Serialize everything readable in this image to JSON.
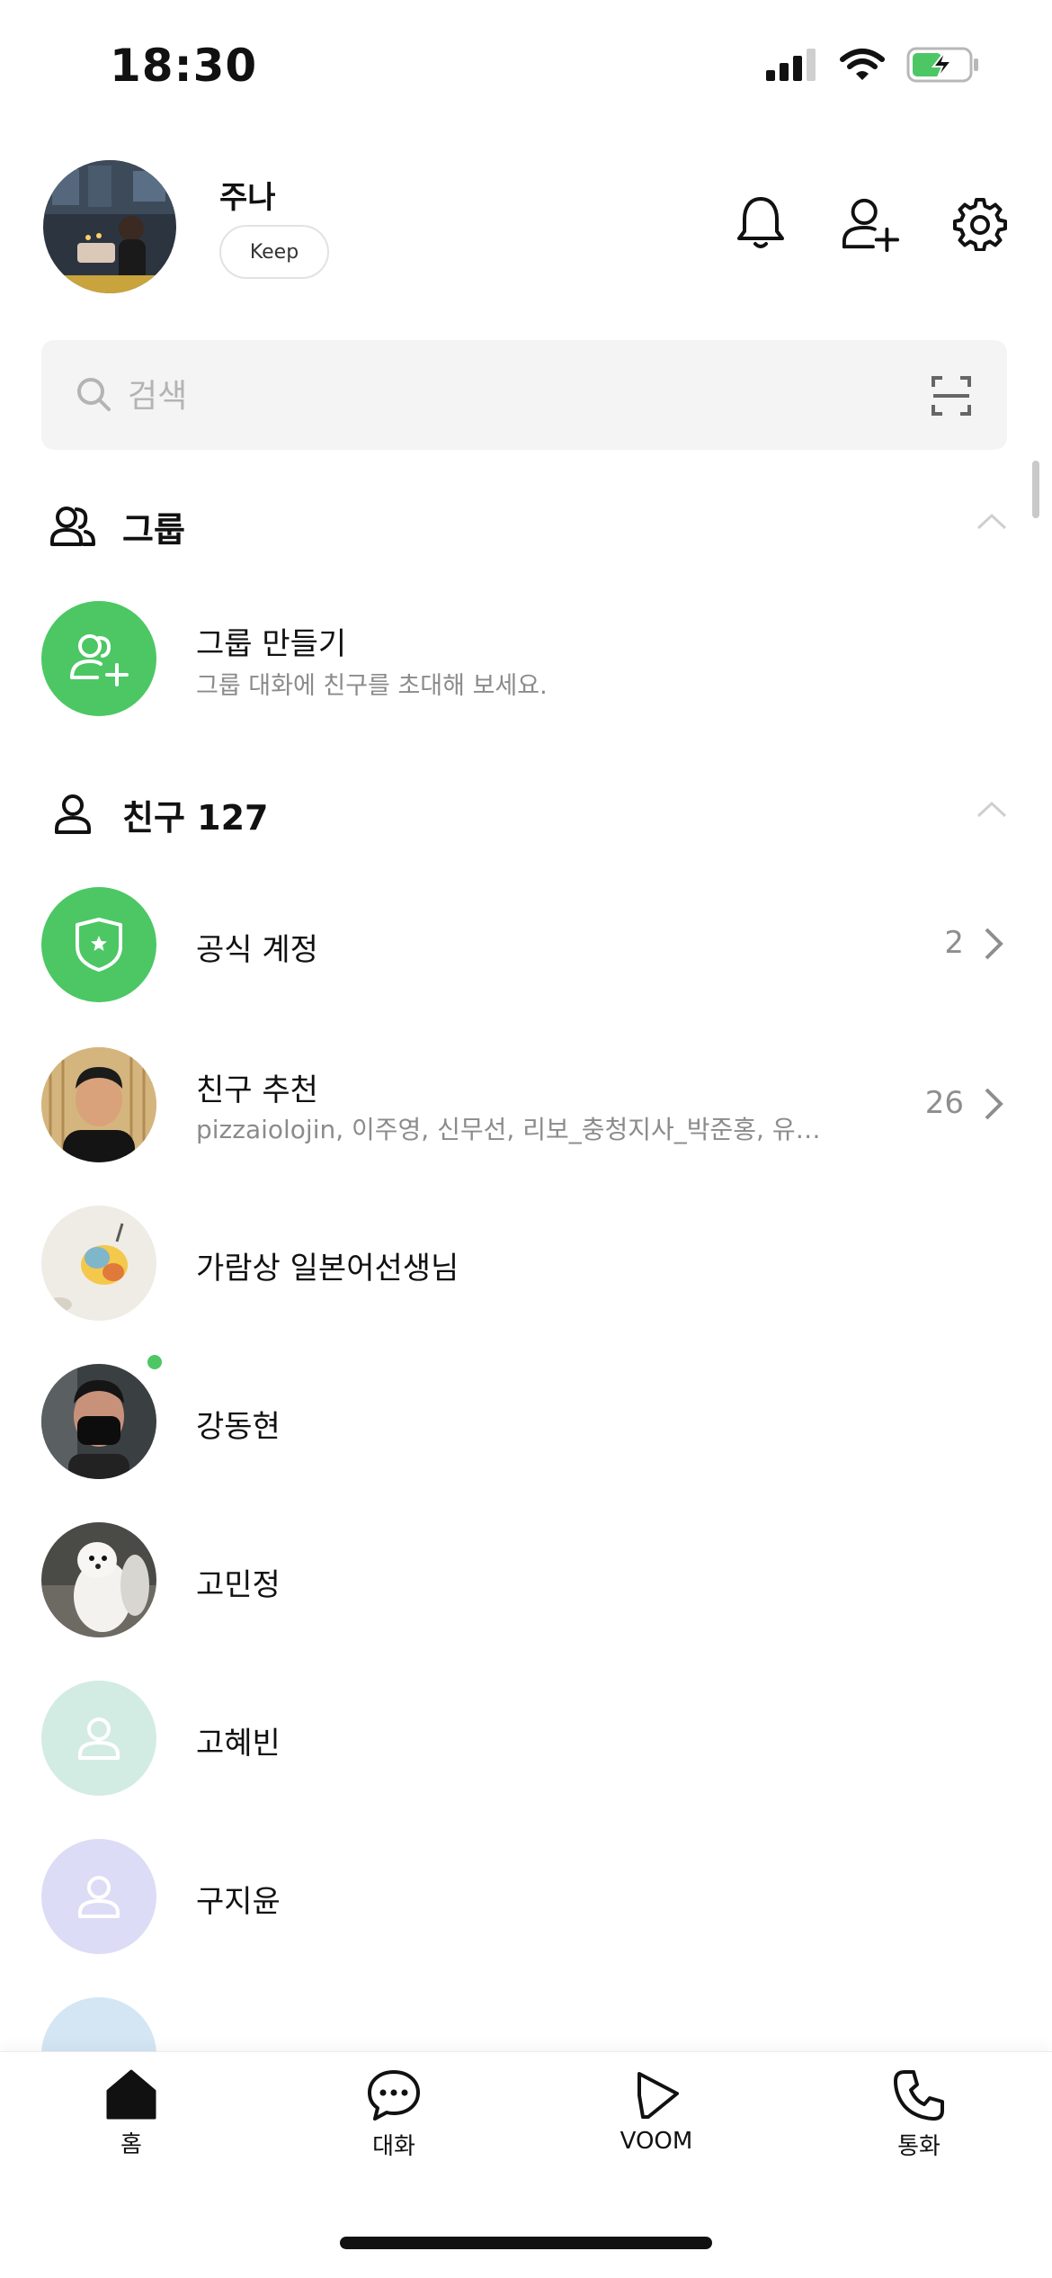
{
  "status_bar": {
    "time": "18:30"
  },
  "profile": {
    "name": "주나",
    "keep_label": "Keep"
  },
  "search": {
    "placeholder": "검색"
  },
  "group_section": {
    "title": "그룹",
    "create_title": "그룹 만들기",
    "create_subtitle": "그룹 대화에 친구를 초대해 보세요."
  },
  "friends_section": {
    "title": "친구 127"
  },
  "official": {
    "title": "공식 계정",
    "count": "2"
  },
  "recommend": {
    "title": "친구 추천",
    "subtitle": "pizzaiolojin, 이주영, 신무선, 리보_충청지사_박준홍, 유…",
    "count": "26"
  },
  "friends": [
    {
      "name": "가람상 일본어선생님"
    },
    {
      "name": "강동현"
    },
    {
      "name": "고민정"
    },
    {
      "name": "고혜빈"
    },
    {
      "name": "구지윤"
    }
  ],
  "nav": {
    "home": "홈",
    "chat": "대화",
    "voom": "VOOM",
    "call": "통화"
  },
  "colors": {
    "accent": "#4cc764",
    "mint_avatar": "#d3ece3",
    "lavender_avatar": "#dcdcf6",
    "sky_avatar": "#d4e6f4"
  }
}
